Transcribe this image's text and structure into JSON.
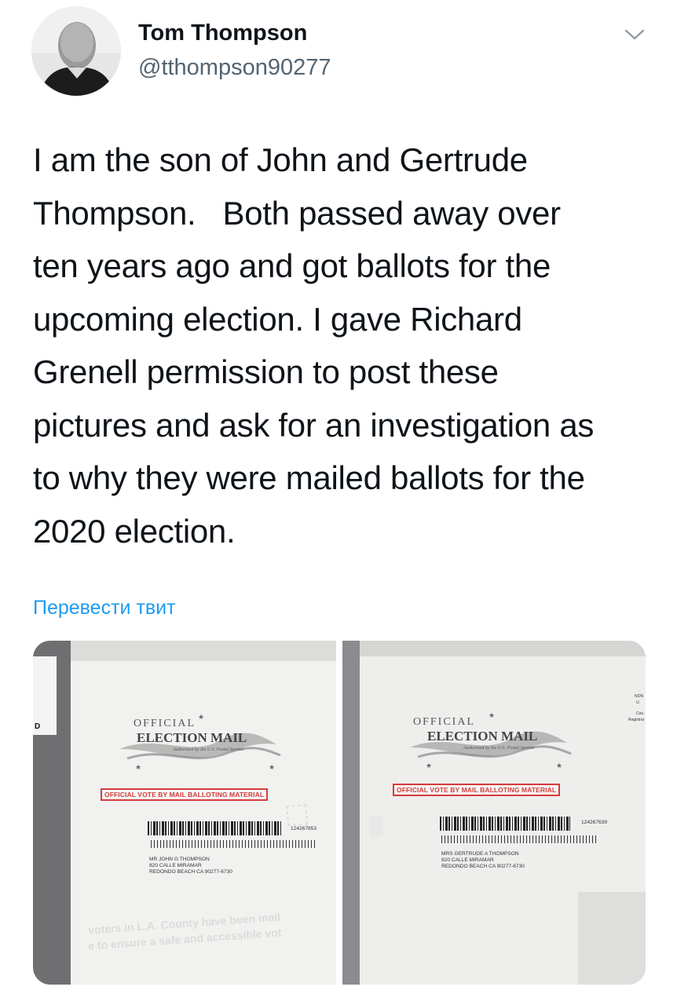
{
  "author": {
    "name": "Tom Thompson",
    "handle": "@tthompson90277"
  },
  "tweet": {
    "lines": [
      "I am the son of John and Gertrude",
      "Thompson.   Both passed away over",
      "ten years ago and got ballots for the",
      "upcoming election. I gave Richard",
      "Grenell permission to post these",
      "pictures and ask for an investigation as",
      "to why they were mailed ballots for the",
      "2020 election."
    ]
  },
  "translate_link": "Перевести твит",
  "media": {
    "left": {
      "edge_label": "D",
      "official_top": "OFFICIAL",
      "official_main": "ELECTION MAIL",
      "official_sub": "Authorized by the U.S. Postal Service",
      "red_box": "OFFICIAL VOTE BY MAIL BALLOTING MATERIAL",
      "barcode_number": "124267853",
      "address_lines": [
        "MR JOHN G THOMPSON",
        "820 CALLE MIRAMAR",
        "REDONDO BEACH CA 90277-6730"
      ],
      "faded_text": [
        "voters in L.A. County have been mail",
        "e to ensure a safe and accessible vot"
      ]
    },
    "right": {
      "official_top": "OFFICIAL",
      "official_main": "ELECTION MAIL",
      "official_sub": "Authorized by the U.S. Postal Service",
      "red_box": "OFFICIAL VOTE BY MAIL BALLOTING MATERIAL",
      "barcode_number": "124267639",
      "address_lines": [
        "MRS GERTRUDE A THOMPSON",
        "820 CALLE MIRAMAR",
        "REDONDO BEACH CA 90277-6730"
      ],
      "corner_text": [
        "NON",
        "U.",
        "Cou",
        "Registrar"
      ]
    }
  },
  "colors": {
    "link": "#1d9bf0",
    "muted": "#536471",
    "red": "#d63b3b"
  },
  "icons": {
    "menu": "chevron-down-icon"
  }
}
